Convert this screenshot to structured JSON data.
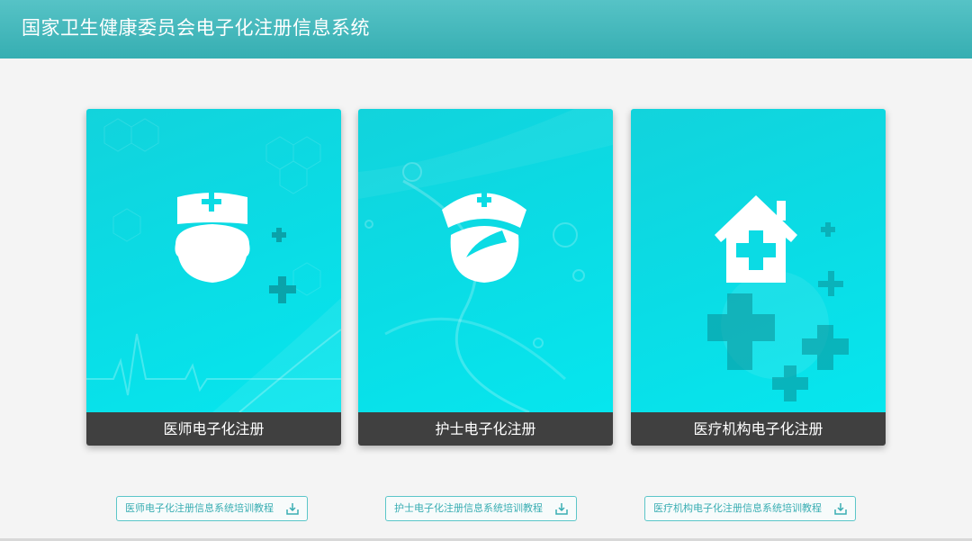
{
  "header": {
    "title": "国家卫生健康委员会电子化注册信息系统"
  },
  "cards": [
    {
      "label": "医师电子化注册",
      "icon": "doctor-icon"
    },
    {
      "label": "护士电子化注册",
      "icon": "nurse-icon"
    },
    {
      "label": "医疗机构电子化注册",
      "icon": "hospital-house-icon"
    }
  ],
  "downloads": [
    {
      "label": "医师电子化注册信息系统培训教程",
      "icon": "download-icon"
    },
    {
      "label": "护士电子化注册信息系统培训教程",
      "icon": "download-icon"
    },
    {
      "label": "医疗机构电子化注册信息系统培训教程",
      "icon": "download-icon"
    }
  ],
  "colors": {
    "header": "#45b9bc",
    "card": "#0bdbe4",
    "label_bar": "#404040",
    "link": "#3aaeb3"
  }
}
